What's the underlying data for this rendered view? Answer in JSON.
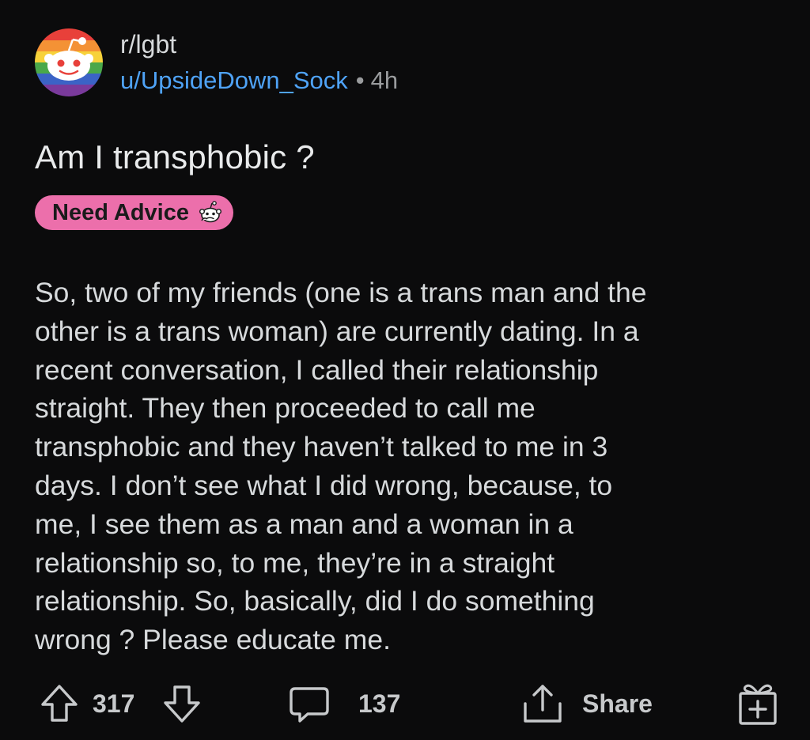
{
  "post": {
    "subreddit": "r/lgbt",
    "username": "u/UpsideDown_Sock",
    "separator": "•",
    "age": "4h",
    "title": "Am I transphobic ?",
    "flair": {
      "label": "Need Advice",
      "icon": "snoo-thinking-icon",
      "color": "#ec6fab"
    },
    "body_lines": [
      "So, two of my friends (one is a trans man and the",
      "other is a trans woman) are currently dating. In a",
      "recent conversation, I called their relationship",
      "straight. They then proceeded to call me",
      "transphobic and they haven’t talked to me in 3",
      "days. I don’t see what I did wrong, because, to",
      "me, I see them as a man and a woman in a",
      "relationship so, to me, they’re in a straight",
      "relationship. So, basically, did I do something",
      "wrong ? Please educate me."
    ]
  },
  "actions": {
    "upvote_icon": "arrow-up-icon",
    "votes": "317",
    "downvote_icon": "arrow-down-icon",
    "comment_icon": "comment-bubble-icon",
    "comments": "137",
    "share_icon": "share-upload-icon",
    "share_label": "Share",
    "award_icon": "gift-box-icon"
  },
  "colors": {
    "background": "#0b0b0c",
    "text": "#d7dadc",
    "username": "#4fa3f7",
    "muted": "#9a9c9e"
  }
}
